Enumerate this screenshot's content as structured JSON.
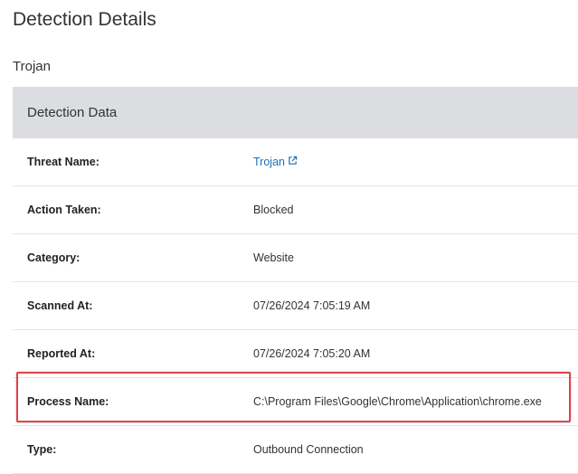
{
  "page_title": "Detection Details",
  "subtitle": "Trojan",
  "section_header": "Detection Data",
  "rows": [
    {
      "label": "Threat Name:",
      "value": "Trojan"
    },
    {
      "label": "Action Taken:",
      "value": "Blocked"
    },
    {
      "label": "Category:",
      "value": "Website"
    },
    {
      "label": "Scanned At:",
      "value": "07/26/2024 7:05:19 AM"
    },
    {
      "label": "Reported At:",
      "value": "07/26/2024 7:05:20 AM"
    },
    {
      "label": "Process Name:",
      "value": "C:\\Program Files\\Google\\Chrome\\Application\\chrome.exe"
    },
    {
      "label": "Type:",
      "value": "Outbound Connection"
    }
  ],
  "colors": {
    "link": "#1f6fb5",
    "highlight": "#e0434b",
    "header_bg": "#dcdde1"
  },
  "icons": {
    "threat_link": "external-link-icon"
  }
}
